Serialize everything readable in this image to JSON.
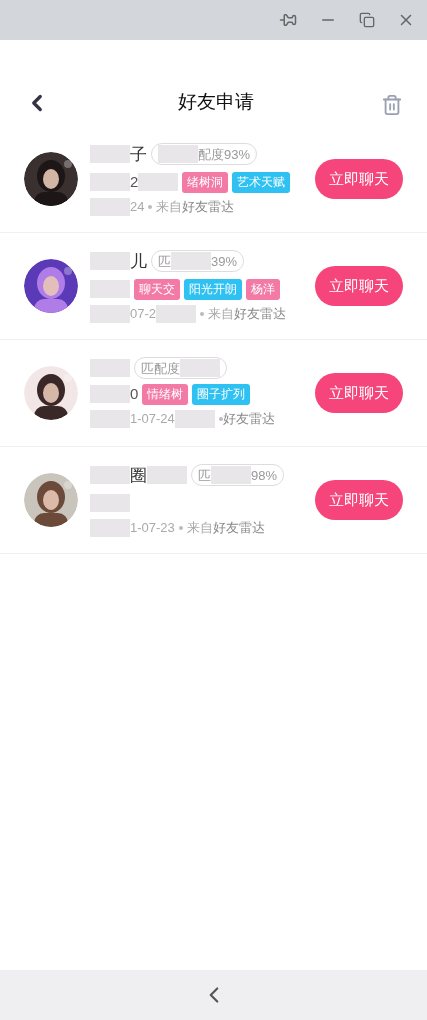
{
  "header": {
    "title": "好友申请"
  },
  "requests": [
    {
      "avatar": {
        "kind": "picture"
      },
      "name": [
        {
          "kind": "blur"
        },
        {
          "kind": "text",
          "text": "子"
        }
      ],
      "match": [
        {
          "kind": "blur"
        },
        {
          "kind": "text",
          "text": "配度93%"
        }
      ],
      "line": [
        {
          "kind": "blur"
        },
        {
          "kind": "text",
          "text": "2"
        },
        {
          "kind": "blur"
        }
      ],
      "tags": [
        {
          "text": "绪树洞",
          "kind": "pink"
        },
        {
          "text": "艺术天赋",
          "kind": "blue"
        }
      ],
      "date": [
        {
          "kind": "blur"
        },
        {
          "kind": "text",
          "text": "24"
        }
      ],
      "source_prefix": "来自",
      "source": "好友雷达",
      "action": "立即聊天"
    },
    {
      "avatar": {
        "kind": "picture"
      },
      "name": [
        {
          "kind": "blur"
        },
        {
          "kind": "text",
          "text": "儿"
        }
      ],
      "match": [
        {
          "kind": "text",
          "text": "匹"
        },
        {
          "kind": "blur"
        },
        {
          "kind": "text",
          "text": "39%"
        }
      ],
      "line": [
        {
          "kind": "blur"
        }
      ],
      "tags": [
        {
          "text": "聊天交",
          "kind": "pink"
        },
        {
          "text": "阳光开朗",
          "kind": "blue"
        },
        {
          "text": "杨洋",
          "kind": "pink"
        }
      ],
      "date": [
        {
          "kind": "blur"
        },
        {
          "kind": "text",
          "text": "07-2"
        },
        {
          "kind": "blur"
        }
      ],
      "source_prefix": "来自",
      "source": "好友雷达",
      "action": "立即聊天"
    },
    {
      "avatar": {
        "kind": "picture"
      },
      "name": [
        {
          "kind": "blur"
        }
      ],
      "match": [
        {
          "kind": "text",
          "text": "匹配度"
        },
        {
          "kind": "blur"
        }
      ],
      "line": [
        {
          "kind": "blur"
        },
        {
          "kind": "text",
          "text": "0"
        }
      ],
      "tags": [
        {
          "text": "情绪树",
          "kind": "pink"
        },
        {
          "text": "圈子扩列",
          "kind": "blue"
        }
      ],
      "date": [
        {
          "kind": "blur"
        },
        {
          "kind": "text",
          "text": "1-07-24"
        },
        {
          "kind": "blur"
        }
      ],
      "source": "好友雷达",
      "action": "立即聊天"
    },
    {
      "avatar": {
        "kind": "picture"
      },
      "name": [
        {
          "kind": "blur"
        },
        {
          "kind": "text",
          "text": "圈"
        },
        {
          "kind": "blur"
        }
      ],
      "match": [
        {
          "kind": "text",
          "text": "匹"
        },
        {
          "kind": "blur"
        },
        {
          "kind": "text",
          "text": "98%"
        }
      ],
      "line": [
        {
          "kind": "blur"
        }
      ],
      "date": [
        {
          "kind": "blur"
        },
        {
          "kind": "text",
          "text": "1-07-23"
        }
      ],
      "source_prefix": "来自",
      "source": "好友雷达",
      "action": "立即聊天"
    }
  ]
}
